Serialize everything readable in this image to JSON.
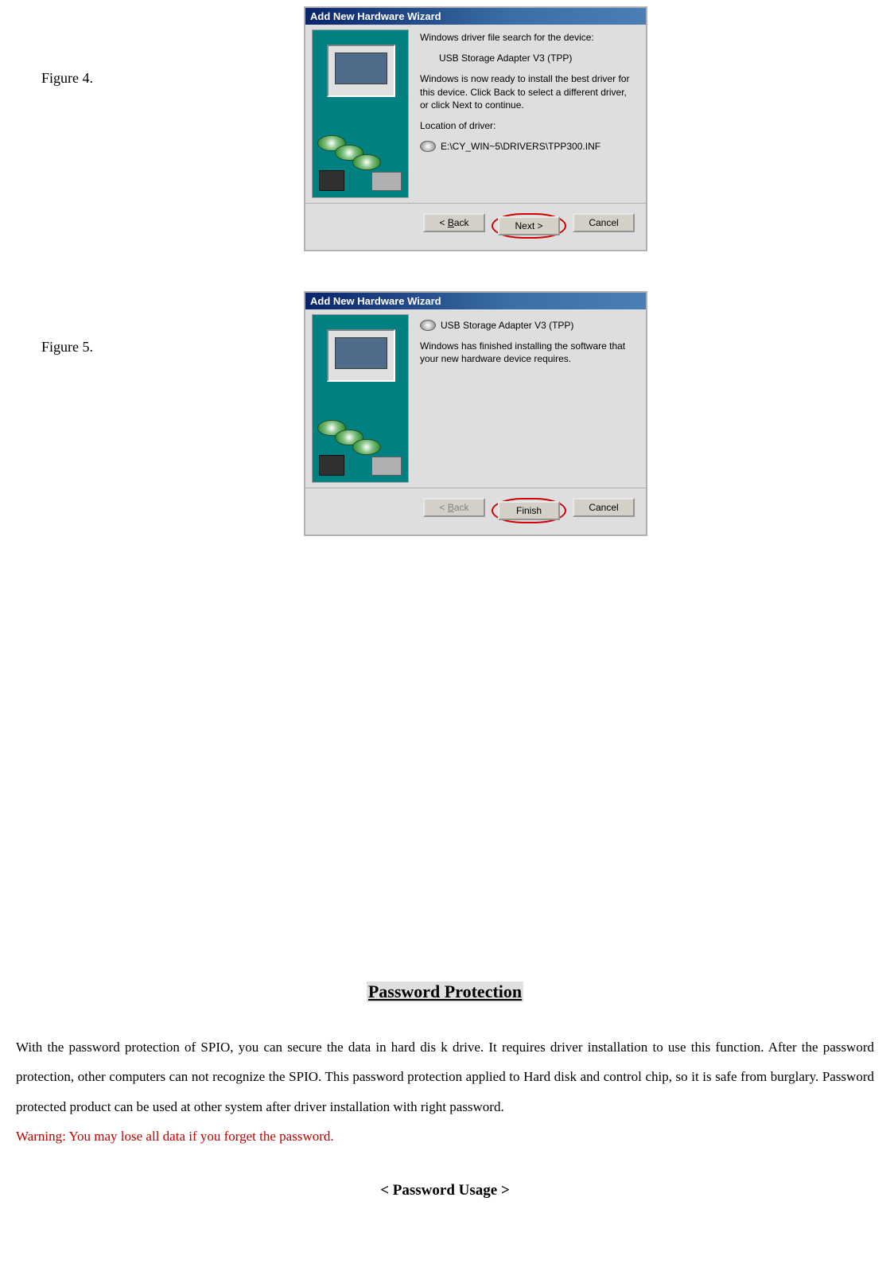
{
  "captions": {
    "fig4": "Figure 4.",
    "fig5": "Figure 5."
  },
  "dialog4": {
    "title": "Add New Hardware Wizard",
    "line1": "Windows driver file search for the device:",
    "device": "USB Storage Adapter V3 (TPP)",
    "ready": "Windows is now ready to install the best driver for this device. Click Back to select a different driver, or click Next to continue.",
    "location_label": "Location of driver:",
    "location_path": "E:\\CY_WIN~5\\DRIVERS\\TPP300.INF",
    "buttons": {
      "back": "< Back",
      "next": "Next >",
      "cancel": "Cancel"
    }
  },
  "dialog5": {
    "title": "Add New Hardware Wizard",
    "device": "USB Storage Adapter V3 (TPP)",
    "finished": "Windows has finished installing the software that your new hardware device requires.",
    "buttons": {
      "back": "< Back",
      "finish": "Finish",
      "cancel": "Cancel"
    }
  },
  "section": {
    "title": "Password Protection",
    "para": "With the password protection of SPIO, you can secure the data in hard dis k drive. It requires driver installation to use this function. After the password protection, other computers can not recognize the SPIO. This password protection applied to Hard disk and control chip, so it is safe from burglary. Password protected product can be used at other system after driver installation with right password.",
    "warning": "Warning: You may lose all data if you forget the password.",
    "subheading": "< Password Usage >"
  }
}
